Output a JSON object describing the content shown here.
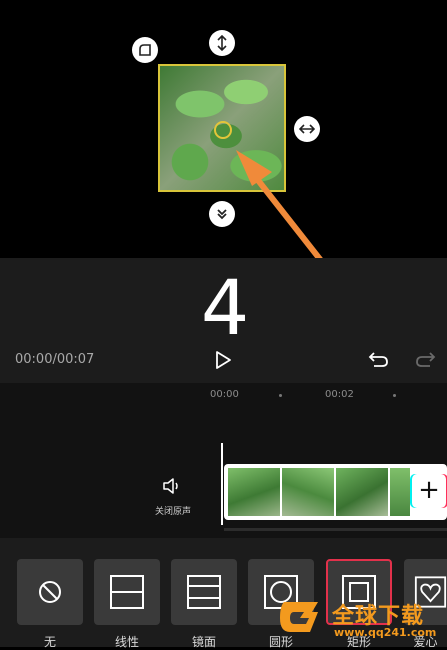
{
  "player": {
    "overlay_number": "4",
    "timecode": "00:00/00:07"
  },
  "timeline": {
    "ruler": [
      "00:00",
      "00:02"
    ],
    "audio_label": "关闭原声",
    "add_clip": "+"
  },
  "masks": {
    "items": [
      {
        "label": "无",
        "icon": "none-icon"
      },
      {
        "label": "线性",
        "icon": "linear-mask-icon"
      },
      {
        "label": "镜面",
        "icon": "mirror-mask-icon"
      },
      {
        "label": "圆形",
        "icon": "circle-mask-icon"
      },
      {
        "label": "矩形",
        "icon": "rectangle-mask-icon",
        "selected": true
      },
      {
        "label": "爱心",
        "icon": "heart-mask-icon"
      }
    ]
  },
  "watermark": {
    "title": "全球下载",
    "url": "www.qq241.com"
  },
  "colors": {
    "mask_frame": "#d8c53a",
    "selected_border": "#e2314b",
    "arrow": "#f08a3a",
    "watermark": "#f39a1e"
  }
}
